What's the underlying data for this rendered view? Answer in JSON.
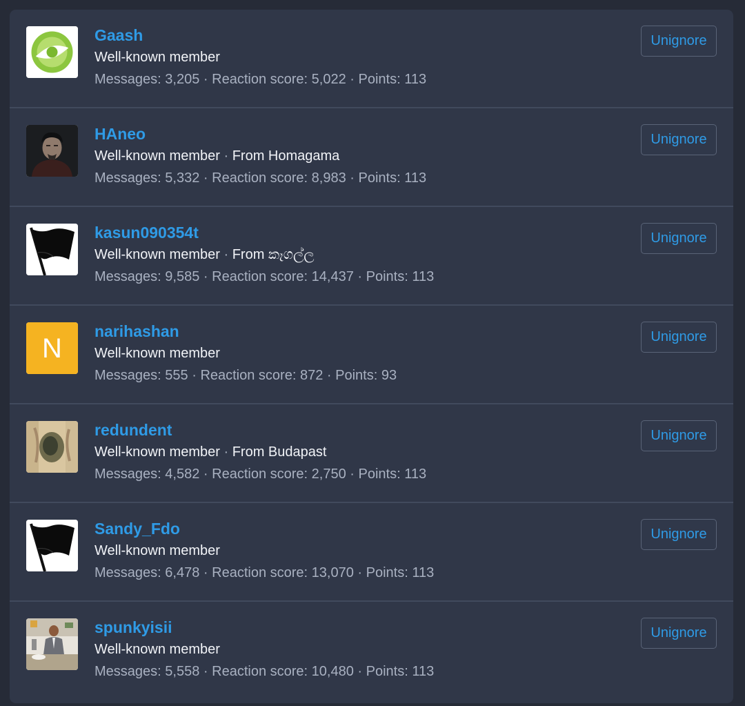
{
  "colors": {
    "page_background": "#262b37",
    "panel_background": "#303748",
    "accent": "#2f9be6",
    "separator": "#414a5d"
  },
  "members": [
    {
      "username": "Gaash",
      "title": "Well-known member",
      "location": "",
      "avatar": "green-circle-logo",
      "stats": {
        "messages_label": "Messages:",
        "messages": "3,205",
        "reaction_label": "Reaction score:",
        "reaction": "5,022",
        "points_label": "Points:",
        "points": "113"
      },
      "button_label": "Unignore"
    },
    {
      "username": "HAneo",
      "title": "Well-known member",
      "location": "From Homagama",
      "avatar": "dark-portrait-photo",
      "stats": {
        "messages_label": "Messages:",
        "messages": "5,332",
        "reaction_label": "Reaction score:",
        "reaction": "8,983",
        "points_label": "Points:",
        "points": "113"
      },
      "button_label": "Unignore"
    },
    {
      "username": "kasun090354t",
      "title": "Well-known member",
      "location": "From කෑගල්ල",
      "avatar": "black-flag-icon",
      "stats": {
        "messages_label": "Messages:",
        "messages": "9,585",
        "reaction_label": "Reaction score:",
        "reaction": "14,437",
        "points_label": "Points:",
        "points": "113"
      },
      "button_label": "Unignore"
    },
    {
      "username": "narihashan",
      "title": "Well-known member",
      "location": "",
      "avatar": "letter-avatar",
      "avatar_letter": "N",
      "avatar_color": "#f5b321",
      "stats": {
        "messages_label": "Messages:",
        "messages": "555",
        "reaction_label": "Reaction score:",
        "reaction": "872",
        "points_label": "Points:",
        "points": "93"
      },
      "button_label": "Unignore"
    },
    {
      "username": "redundent",
      "title": "Well-known member",
      "location": "From Budapast",
      "avatar": "painting-photo",
      "stats": {
        "messages_label": "Messages:",
        "messages": "4,582",
        "reaction_label": "Reaction score:",
        "reaction": "2,750",
        "points_label": "Points:",
        "points": "113"
      },
      "button_label": "Unignore"
    },
    {
      "username": "Sandy_Fdo",
      "title": "Well-known member",
      "location": "",
      "avatar": "black-flag-icon",
      "stats": {
        "messages_label": "Messages:",
        "messages": "6,478",
        "reaction_label": "Reaction score:",
        "reaction": "13,070",
        "points_label": "Points:",
        "points": "113"
      },
      "button_label": "Unignore"
    },
    {
      "username": "spunkyisii",
      "title": "Well-known member",
      "location": "",
      "avatar": "man-in-suit-photo",
      "stats": {
        "messages_label": "Messages:",
        "messages": "5,558",
        "reaction_label": "Reaction score:",
        "reaction": "10,480",
        "points_label": "Points:",
        "points": "113"
      },
      "button_label": "Unignore"
    }
  ]
}
